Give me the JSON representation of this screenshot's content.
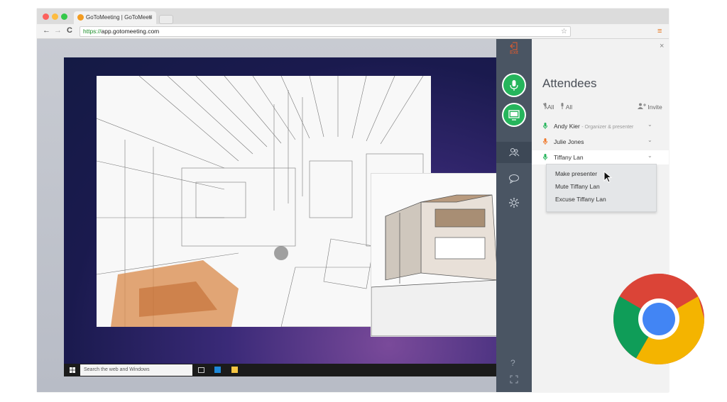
{
  "browser": {
    "tab_title": "GoToMeeting | GoToMeeti",
    "tab_close": "×",
    "url_scheme": "https://",
    "url_host": "app.gotomeeting.com",
    "back": "←",
    "forward": "→",
    "reload": "C",
    "star": "☆",
    "menu": "≡",
    "colors": {
      "close": "#fc615d",
      "minimize": "#fdbc40",
      "zoom": "#34c84a"
    }
  },
  "shared_screen": {
    "taskbar_search_placeholder": "Search the web and Windows"
  },
  "rail": {
    "exit_label": "Exit",
    "mic_icon": "microphone-icon",
    "screen_icon": "screen-share-icon",
    "people_icon": "people-icon",
    "chat_icon": "chat-icon",
    "settings_icon": "gear-icon",
    "help": "?",
    "expand_icon": "expand-icon"
  },
  "attendees": {
    "title": "Attendees",
    "close": "×",
    "mute_all": "All",
    "unmute_all": "All",
    "invite": "Invite",
    "list": [
      {
        "name": "Andy Kier",
        "role": "- Organizer & presenter",
        "mic_color": "#26b55c"
      },
      {
        "name": "Julie Jones",
        "role": "",
        "mic_color": "#f0782a"
      },
      {
        "name": "Tiffany Lan",
        "role": "",
        "mic_color": "#26b55c"
      }
    ],
    "chevron": "⌄",
    "context_menu": [
      "Make presenter",
      "Mute Tiffany Lan",
      "Excuse Tiffany Lan"
    ]
  },
  "accent": "#26b55c"
}
